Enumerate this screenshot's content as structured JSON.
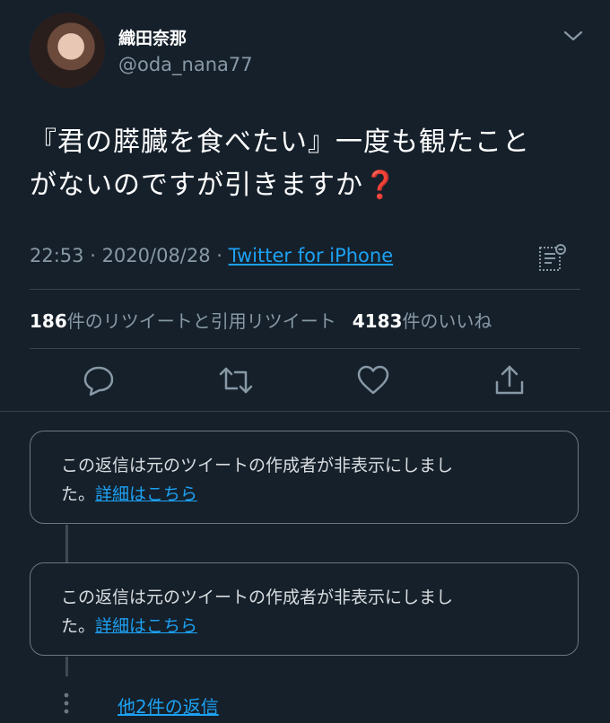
{
  "tweet": {
    "author_name": "織田奈那",
    "author_handle": "@oda_nana77",
    "text_part1": "『君の膵臓を食べたい』一度も観たこと",
    "text_part2": "がないのですが引きますか",
    "text_emoji": "❓",
    "time": "22:53",
    "date": "2020/08/28",
    "separator": " · ",
    "source": "Twitter for iPhone"
  },
  "stats": {
    "retweets_count": "186",
    "retweets_label": "件のリツイートと引用リツイート",
    "likes_count": "4183",
    "likes_label": "件のいいね"
  },
  "icons": {
    "caret": "chevron-down-icon",
    "analytics": "analytics-icon",
    "reply": "reply-icon",
    "retweet": "retweet-icon",
    "like": "heart-icon",
    "share": "share-icon",
    "more": "more-vertical-icon"
  },
  "hidden_replies": [
    {
      "text_line1": "この返信は元のツイートの作成者が非表示にしまし",
      "text_line2": "た。",
      "link": "詳細はこちら"
    },
    {
      "text_line1": "この返信は元のツイートの作成者が非表示にしまし",
      "text_line2": "た。",
      "link": "詳細はこちら"
    }
  ],
  "more_replies": "他2件の返信",
  "colors": {
    "background": "#15202b",
    "secondary_text": "#8899a6",
    "accent": "#1da1f2",
    "emoji": "#e0245e"
  }
}
